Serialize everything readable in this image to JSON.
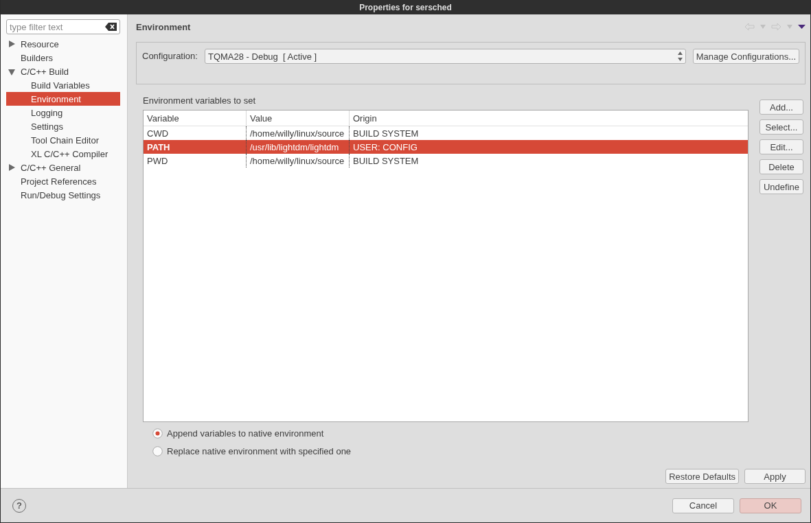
{
  "window": {
    "title": "Properties for sersched"
  },
  "filter": {
    "placeholder": "type filter text"
  },
  "tree": [
    {
      "label": "Resource",
      "expanded": false,
      "selected": false
    },
    {
      "label": "Builders",
      "selected": false
    },
    {
      "label": "C/C++ Build",
      "expanded": true,
      "selected": false,
      "children": [
        {
          "label": "Build Variables",
          "selected": false
        },
        {
          "label": "Environment",
          "selected": true
        },
        {
          "label": "Logging",
          "selected": false
        },
        {
          "label": "Settings",
          "selected": false
        },
        {
          "label": "Tool Chain Editor",
          "selected": false
        },
        {
          "label": "XL C/C++ Compiler",
          "selected": false
        }
      ]
    },
    {
      "label": "C/C++ General",
      "expanded": false,
      "selected": false
    },
    {
      "label": "Project References",
      "selected": false
    },
    {
      "label": "Run/Debug Settings",
      "selected": false
    }
  ],
  "page": {
    "title": "Environment"
  },
  "configuration": {
    "label": "Configuration:",
    "value": "TQMA28 - Debug  [ Active ]",
    "manage_button": "Manage Configurations..."
  },
  "table": {
    "caption": "Environment variables to set",
    "columns": [
      "Variable",
      "Value",
      "Origin"
    ],
    "rows": [
      {
        "cells": [
          "CWD",
          "/home/willy/linux/source",
          "BUILD SYSTEM"
        ],
        "selected": false
      },
      {
        "cells": [
          "PATH",
          "/usr/lib/lightdm/lightdm",
          "USER: CONFIG"
        ],
        "selected": true
      },
      {
        "cells": [
          "PWD",
          "/home/willy/linux/source",
          "BUILD SYSTEM"
        ],
        "selected": false
      }
    ]
  },
  "side_buttons": [
    "Add...",
    "Select...",
    "Edit...",
    "Delete",
    "Undefine"
  ],
  "radios": [
    {
      "label": "Append variables to native environment",
      "selected": true
    },
    {
      "label": "Replace native environment with specified one",
      "selected": false
    }
  ],
  "page_buttons": [
    "Restore Defaults",
    "Apply"
  ],
  "help": "?",
  "dialog_buttons": [
    {
      "label": "Cancel",
      "kind": "normal"
    },
    {
      "label": "OK",
      "kind": "default"
    }
  ]
}
